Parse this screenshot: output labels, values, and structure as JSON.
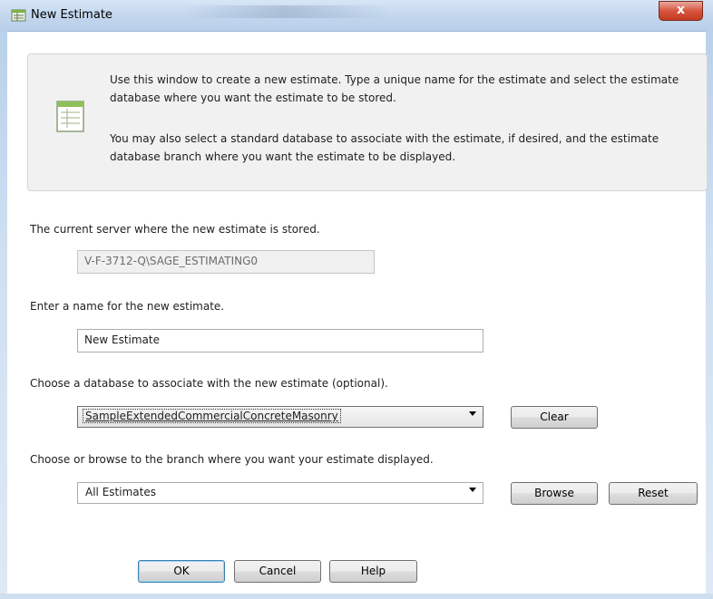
{
  "window": {
    "title": "New Estimate",
    "close_glyph": "x",
    "icon": "app-estimate-icon"
  },
  "info": {
    "icon": "estimate-document-icon",
    "paragraph1": "Use this window to create a new estimate. Type a unique name for the estimate and select the estimate database where you want the estimate to be stored.",
    "paragraph2": "You may also select a standard database to associate with the estimate, if desired, and the estimate database branch where you want the estimate to be displayed."
  },
  "server": {
    "label": "The current server where the new estimate is stored.",
    "value": "V-F-3712-Q\\SAGE_ESTIMATING0"
  },
  "name": {
    "label": "Enter a name for the new estimate.",
    "value": "New Estimate"
  },
  "database": {
    "label": "Choose a database to associate with the new estimate (optional).",
    "selected": "SampleExtendedCommercialConcreteMasonry",
    "clear_label": "Clear"
  },
  "branch": {
    "label": "Choose or browse to the branch where you want your estimate displayed.",
    "selected": "All Estimates",
    "browse_label": "Browse",
    "reset_label": "Reset"
  },
  "footer": {
    "ok_label": "OK",
    "cancel_label": "Cancel",
    "help_label": "Help"
  }
}
